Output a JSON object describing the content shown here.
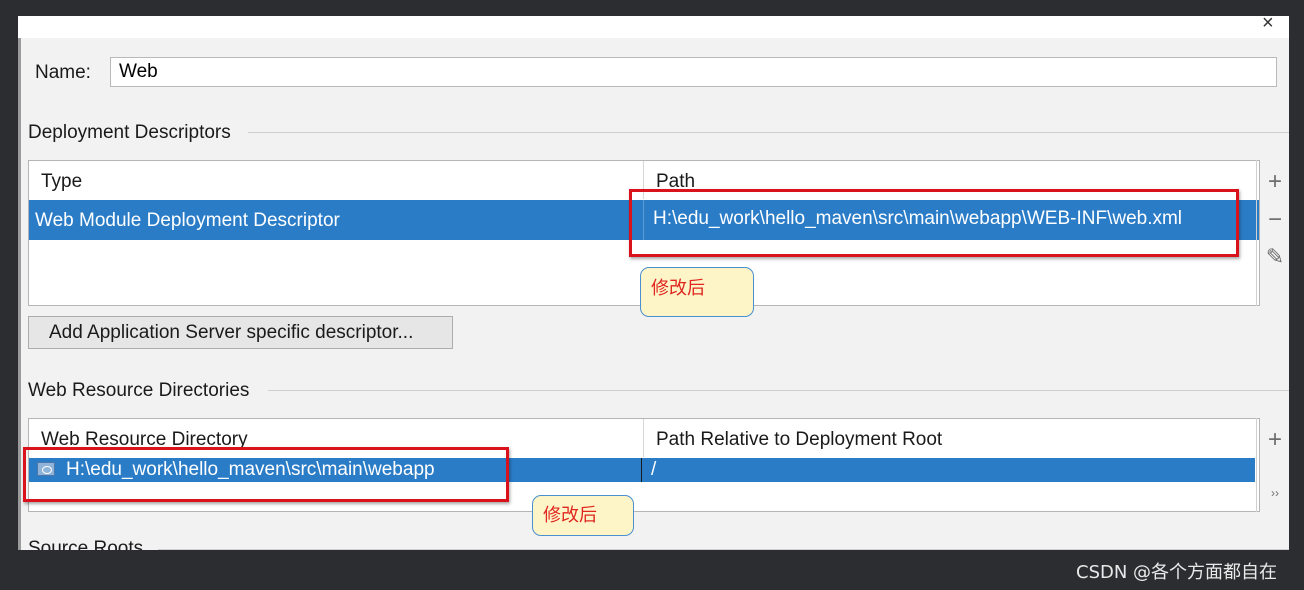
{
  "dialog": {
    "close_glyph": "×",
    "name_label": "Name:",
    "name_value": "Web"
  },
  "deployment_descriptors": {
    "title": "Deployment Descriptors",
    "columns": [
      "Type",
      "Path"
    ],
    "rows": [
      {
        "type": "Web Module Deployment Descriptor",
        "path": "H:\\edu_work\\hello_maven\\src\\main\\webapp\\WEB-INF\\web.xml"
      }
    ],
    "add_icon": "plus-icon",
    "remove_icon": "minus-icon",
    "edit_icon": "pencil-icon",
    "add_server_button": "Add Application Server specific descriptor..."
  },
  "web_resource_directories": {
    "title": "Web Resource Directories",
    "columns": [
      "Web Resource Directory",
      "Path Relative to Deployment Root"
    ],
    "rows": [
      {
        "directory": "H:\\edu_work\\hello_maven\\src\\main\\webapp",
        "relative_path": "/"
      }
    ],
    "add_icon": "plus-icon",
    "more_icon": "double-chevron-right-icon"
  },
  "source_roots": {
    "title": "Source Roots"
  },
  "annotations": {
    "callout_1": "修改后",
    "callout_2": "修改后"
  },
  "watermark": "CSDN @各个方面都自在",
  "colors": {
    "selection": "#2a7cc7",
    "annotation_box": "#d9121c",
    "callout_text": "#e0261f",
    "callout_bg": "#fdf5c8"
  }
}
